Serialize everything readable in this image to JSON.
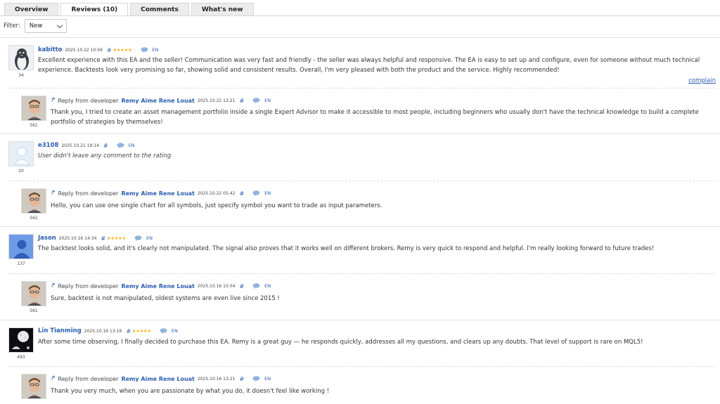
{
  "tabs": [
    {
      "label": "Overview",
      "active": false
    },
    {
      "label": "Reviews (10)",
      "active": true
    },
    {
      "label": "Comments",
      "active": false
    },
    {
      "label": "What's new",
      "active": false
    }
  ],
  "filter": {
    "label": "Filter:",
    "value": "New"
  },
  "complain": "complain",
  "reply_label": "Reply from developer",
  "lang": "EN",
  "hash": "#",
  "reviews": [
    {
      "name": "kabitto",
      "date": "2025.10.22 10:56",
      "stars": "★★★★★",
      "count": "34",
      "text": "Excellent experience with this EA and the seller! Communication was very fast and friendly - the seller was always helpful and responsive. The EA is easy to set up and configure, even for someone without much technical experience. Backtests look very promising so far, showing solid and consistent results. Overall, I'm very pleased with both the product and the service. Highly recommended!",
      "reply": {
        "developer": "Remy Aime Rene Louat",
        "date": "2025.10.22 12:21",
        "count": "561",
        "text": "Thank you, I tried to create an asset management portfolio inside a single Expert Advisor to make it accessible to most people, including beginners who usually don't have the technical knowledge to build a complete portfolio of strategies by themselves!"
      }
    },
    {
      "name": "e3108",
      "date": "2025.10.21 19:14",
      "stars": "",
      "count": "20",
      "text": "User didn't leave any comment to the rating",
      "reply": {
        "developer": "Remy Aime Rene Louat",
        "date": "2025.10.22 05:42",
        "count": "561",
        "text": "Hello, you can use one single chart for all symbols, just specify symbol you want to trade as input parameters."
      }
    },
    {
      "name": "Jason",
      "date": "2025.10.16 14:34",
      "stars": "★★★★★",
      "count": "137",
      "text": "The backtest looks solid, and it's clearly not manipulated. The signal also proves that it works well on different brokers. Remy is very quick to respond and helpful. I'm really looking forward to future trades!",
      "reply": {
        "developer": "Remy Aime Rene Louat",
        "date": "2025.10.16 15:04",
        "count": "561",
        "text": "Sure, backtest is not manipulated, oldest systems are even live since 2015 !"
      }
    },
    {
      "name": "Lin Tianming",
      "date": "2025.10.16 13:16",
      "stars": "★★★★★",
      "count": "493",
      "text": "After some time observing, I finally decided to purchase this EA. Remy is a great guy — he responds quickly, addresses all my questions, and clears up any doubts. That level of support is rare on MQL5!",
      "reply": {
        "developer": "Remy Aime Rene Louat",
        "date": "2025.10.16 13:21",
        "count": "561",
        "text": "Thank you very much, when you are passionate by what you do, it doesn't feel like working !"
      }
    }
  ]
}
